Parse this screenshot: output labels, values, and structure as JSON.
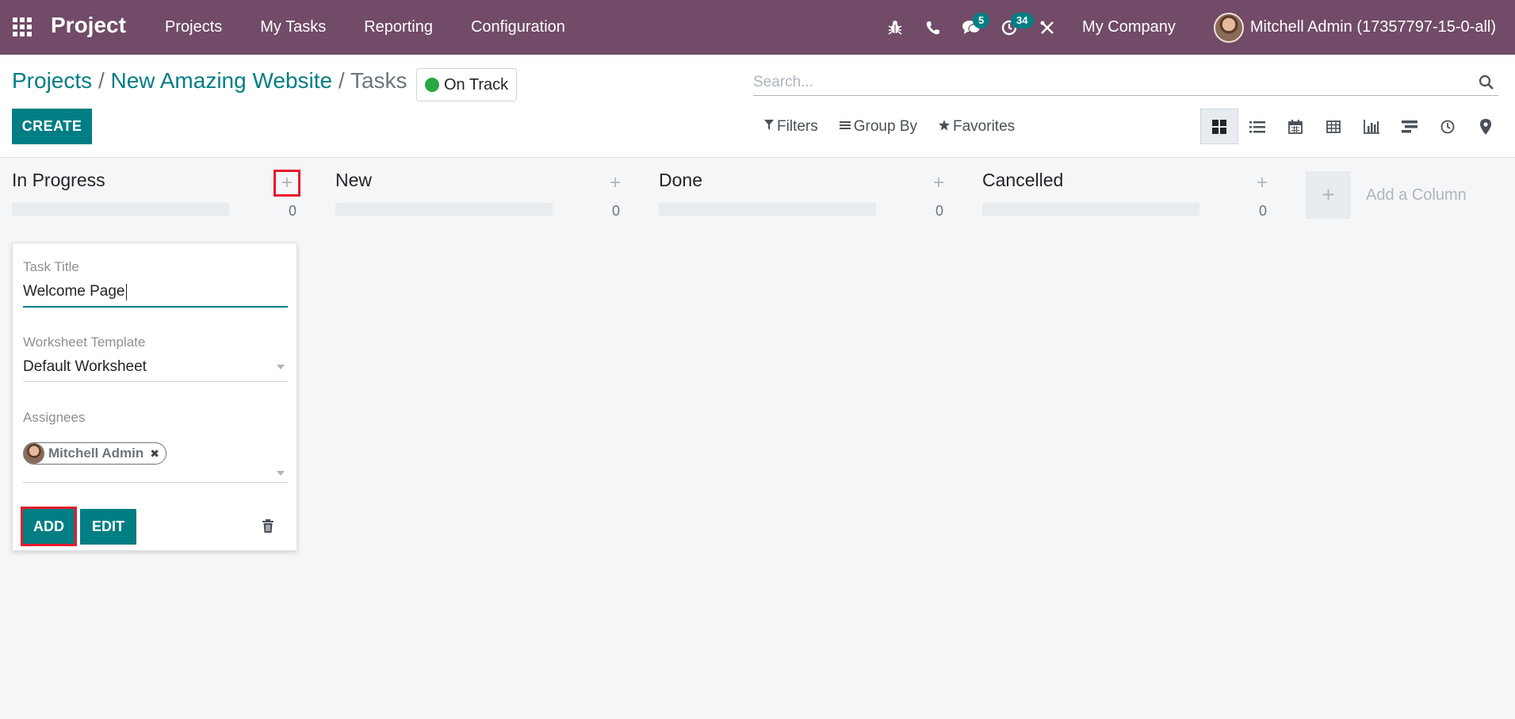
{
  "app": {
    "name": "Project"
  },
  "nav": {
    "menu": [
      "Projects",
      "My Tasks",
      "Reporting",
      "Configuration"
    ],
    "messages_count": "5",
    "activities_count": "34",
    "company": "My Company",
    "user": "Mitchell Admin (17357797-15-0-all)"
  },
  "breadcrumb": {
    "items": [
      "Projects",
      "New Amazing Website",
      "Tasks"
    ],
    "sep": "/"
  },
  "status": {
    "label": "On Track",
    "color": "#28a745"
  },
  "search": {
    "placeholder": "Search..."
  },
  "toolbar": {
    "create_label": "CREATE",
    "filters_label": "Filters",
    "group_by_label": "Group By",
    "favorites_label": "Favorites",
    "views": [
      "kanban",
      "list",
      "calendar",
      "pivot",
      "graph",
      "gantt",
      "activity",
      "map"
    ],
    "active_view": "kanban"
  },
  "kanban": {
    "columns": [
      {
        "title": "In Progress",
        "count": "0"
      },
      {
        "title": "New",
        "count": "0"
      },
      {
        "title": "Done",
        "count": "0"
      },
      {
        "title": "Cancelled",
        "count": "0"
      }
    ],
    "add_column_label": "Add a Column"
  },
  "quick_create": {
    "task_title_label": "Task Title",
    "task_title_value": "Welcome Page",
    "worksheet_label": "Worksheet Template",
    "worksheet_value": "Default Worksheet",
    "assignees_label": "Assignees",
    "assignee": "Mitchell Admin",
    "add_label": "ADD",
    "edit_label": "EDIT"
  },
  "colors": {
    "navbar": "#714b67",
    "primary": "#017e84",
    "highlight": "#e8192c"
  }
}
